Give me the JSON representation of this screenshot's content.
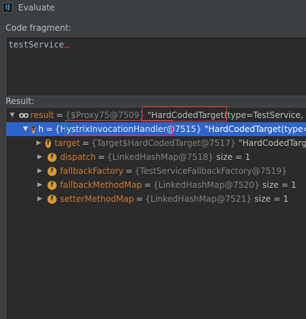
{
  "window": {
    "title": "Evaluate"
  },
  "code": {
    "label": "Code fragment:",
    "expression": "testService"
  },
  "result": {
    "label": "Result:",
    "rows": [
      {
        "name": "result",
        "type": "{$Proxy75@7509}",
        "value": "\"HardCodedTarget(type=TestService, na"
      },
      {
        "name": "h",
        "type": "{HystrixInvocationHandler@7515}",
        "value": "\"HardCodedTarget(type="
      },
      {
        "name": "target",
        "type": "{Target$HardCodedTarget@7517}",
        "value": "\"HardCodedTarg"
      },
      {
        "name": "dispatch",
        "type": "{LinkedHashMap@7518}",
        "value": "size = 1"
      },
      {
        "name": "fallbackFactory",
        "type": "{TestServiceFallbackFactory@7519}",
        "value": ""
      },
      {
        "name": "fallbackMethodMap",
        "type": "{LinkedHashMap@7520}",
        "value": "size = 1"
      },
      {
        "name": "setterMethodMap",
        "type": "{LinkedHashMap@7521}",
        "value": "size = 1"
      }
    ]
  },
  "icons": {
    "watch": "glasses-icon",
    "field": "field-icon"
  },
  "colors": {
    "selection": "#2f65ca",
    "highlight_box": "#e0343a",
    "field_icon": "#d79a2f"
  }
}
